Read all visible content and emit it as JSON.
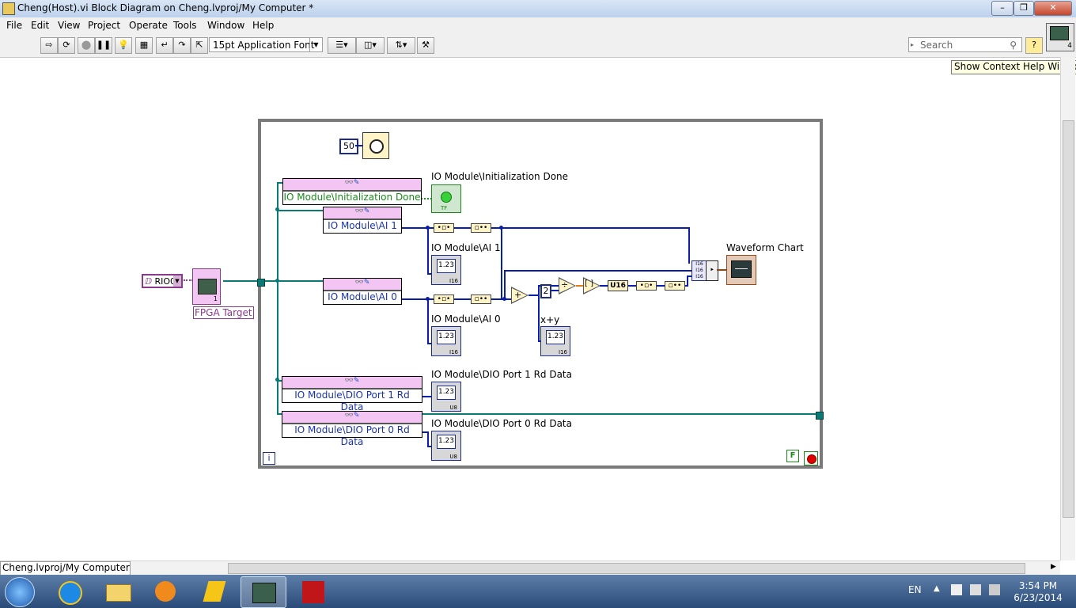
{
  "window": {
    "title": "Cheng(Host).vi Block Diagram on Cheng.lvproj/My Computer *"
  },
  "menu": [
    "File",
    "Edit",
    "View",
    "Project",
    "Operate",
    "Tools",
    "Window",
    "Help"
  ],
  "toolbar": {
    "font": "15pt Application Font",
    "search_placeholder": "Search",
    "tooltip": "Show Context Help Window",
    "vi_count": "4"
  },
  "diagram": {
    "wait_ms": "50",
    "divisor": "2",
    "fpga_ref": "RIO0",
    "fpga_target": "FPGA Target",
    "fpga_num": "1",
    "conv_type": "U16",
    "loop_stop": "F",
    "iteration": "i",
    "read_nodes": {
      "init_done": "IO Module\\Initialization Done",
      "ai1": "IO Module\\AI 1",
      "ai0": "IO Module\\AI 0",
      "dio1": "IO Module\\DIO Port 1 Rd Data",
      "dio0": "IO Module\\DIO Port 0 Rd Data"
    },
    "indicators": {
      "init_done": "IO Module\\Initialization Done",
      "ai1": "IO Module\\AI 1",
      "ai0": "IO Module\\AI 0",
      "sum": "x+y",
      "dio1": "IO Module\\DIO Port 1 Rd Data",
      "dio0": "IO Module\\DIO Port 0 Rd Data",
      "chart": "Waveform Chart"
    },
    "numeric_glyph": "1.23",
    "bool_glyph": "TF",
    "type_i16": "I16",
    "type_u8": "U8"
  },
  "status": {
    "project": "Cheng.lvproj/My Computer"
  },
  "taskbar": {
    "lang": "EN",
    "time": "3:54 PM",
    "date": "6/23/2014"
  }
}
